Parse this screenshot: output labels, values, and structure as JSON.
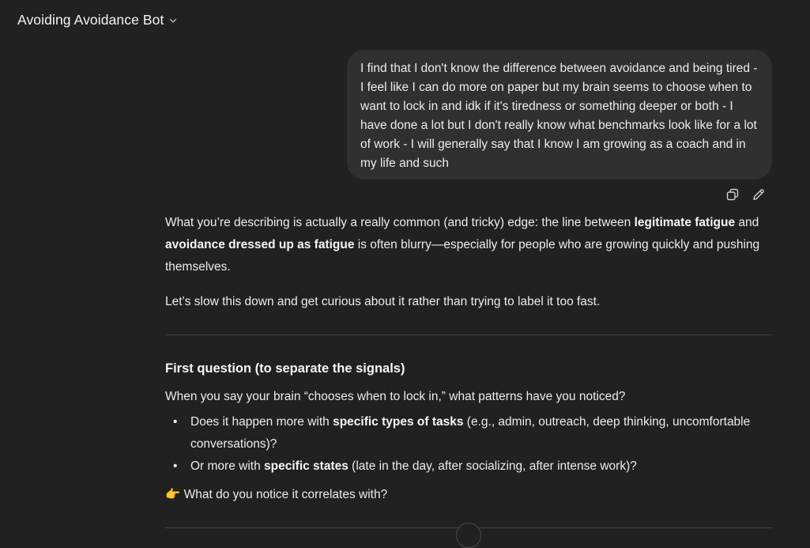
{
  "header": {
    "title": "Avoiding Avoidance Bot",
    "chevron_icon": "chevron-down-icon"
  },
  "user_message": {
    "text": "I find that I don't know the difference between avoidance and being tired - I feel like I can do more on paper but my brain seems to choose when to want to lock in and idk if it's tiredness or something deeper or both - I have done a lot but I don't really know what benchmarks look like for a lot of work - I will generally say that I know I am growing as a coach and in my life and such"
  },
  "message_actions": {
    "copy_icon": "copy-icon",
    "edit_icon": "edit-pencil-icon"
  },
  "assistant": {
    "p1": {
      "t1": "What you’re describing is actually a really common (and tricky) edge: the line between ",
      "b1": "legitimate fatigue",
      "t2": " and ",
      "b2": "avoidance dressed up as fatigue",
      "t3": " is often blurry—especially for people who are growing quickly and pushing themselves."
    },
    "p2": "Let’s slow this down and get curious about it rather than trying to label it too fast.",
    "heading": "First question (to separate the signals)",
    "question": "When you say your brain “chooses when to lock in,” what patterns have you noticed?",
    "bullets": [
      {
        "pre": "Does it happen more with ",
        "bold": "specific types of tasks",
        "post": " (e.g., admin, outreach, deep thinking, uncomfortable conversations)?"
      },
      {
        "pre": "Or more with ",
        "bold": "specific states",
        "post": " (late in the day, after socializing, after intense work)?"
      }
    ],
    "pointer_emoji": "👉",
    "prompt": " What do you notice it correlates with?"
  },
  "colors": {
    "background": "#212121",
    "bubble": "#303030",
    "text": "#ececec"
  }
}
